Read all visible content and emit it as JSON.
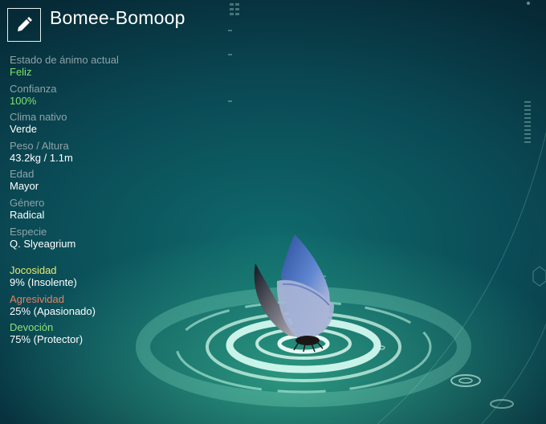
{
  "creature": {
    "name": "Bomee-Bomoop"
  },
  "stats": [
    {
      "label": "Estado de ánimo actual",
      "value": "Feliz"
    },
    {
      "label": "Confianza",
      "value": "100%"
    },
    {
      "label": "Clima nativo",
      "value": "Verde"
    },
    {
      "label": "Peso / Altura",
      "value": "43.2kg / 1.1m"
    },
    {
      "label": "Edad",
      "value": "Mayor"
    },
    {
      "label": "Género",
      "value": "Radical"
    },
    {
      "label": "Especie",
      "value": "Q. Slyeagrium"
    }
  ],
  "traits": [
    {
      "label": "Jocosidad",
      "value": "9% (Insolente)"
    },
    {
      "label": "Agresividad",
      "value": "25% (Apasionado)"
    },
    {
      "label": "Devoción",
      "value": "75% (Protector)"
    }
  ],
  "colors": {
    "value_highlight": "#7ee36a",
    "trait_jocosidad": "#e7e96b",
    "trait_agresividad": "#e8805e",
    "trait_devocion": "#8ee27a"
  },
  "icons": {
    "edit": "pencil-icon"
  }
}
